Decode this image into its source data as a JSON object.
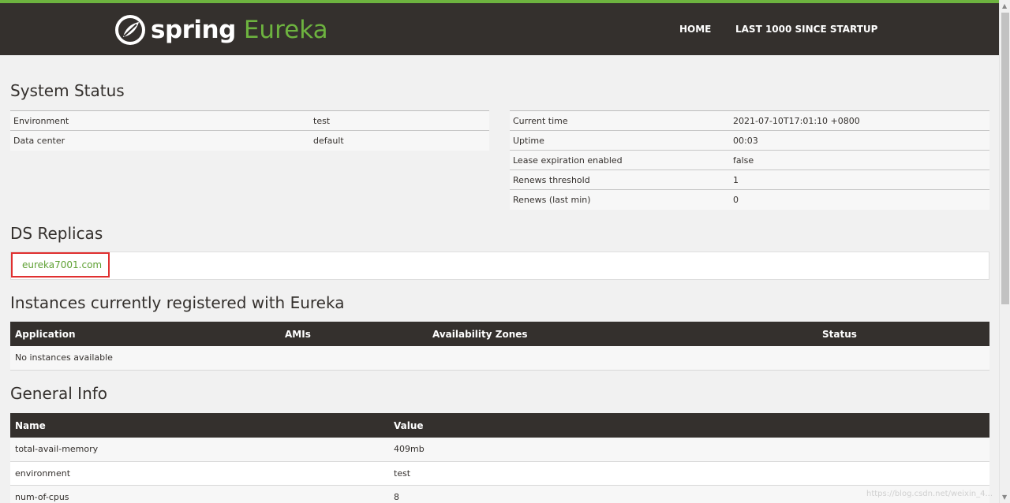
{
  "header": {
    "logo_word": "spring",
    "logo_product": "Eureka",
    "nav_home": "HOME",
    "nav_last": "LAST 1000 SINCE STARTUP",
    "brand_color": "#6db33f",
    "bar_color": "#34302d"
  },
  "system_status": {
    "title": "System Status",
    "left": [
      {
        "key": "Environment",
        "value": "test"
      },
      {
        "key": "Data center",
        "value": "default"
      }
    ],
    "right": [
      {
        "key": "Current time",
        "value": "2021-07-10T17:01:10 +0800"
      },
      {
        "key": "Uptime",
        "value": "00:03"
      },
      {
        "key": "Lease expiration enabled",
        "value": "false"
      },
      {
        "key": "Renews threshold",
        "value": "1"
      },
      {
        "key": "Renews (last min)",
        "value": "0"
      }
    ]
  },
  "replicas": {
    "title": "DS Replicas",
    "items": [
      "eureka7001.com"
    ]
  },
  "instances": {
    "title": "Instances currently registered with Eureka",
    "headers": [
      "Application",
      "AMIs",
      "Availability Zones",
      "Status"
    ],
    "empty": "No instances available"
  },
  "general_info": {
    "title": "General Info",
    "headers": [
      "Name",
      "Value"
    ],
    "rows": [
      {
        "name": "total-avail-memory",
        "value": "409mb"
      },
      {
        "name": "environment",
        "value": "test"
      },
      {
        "name": "num-of-cpus",
        "value": "8"
      }
    ]
  },
  "watermark": "https://blog.csdn.net/weixin_4..."
}
